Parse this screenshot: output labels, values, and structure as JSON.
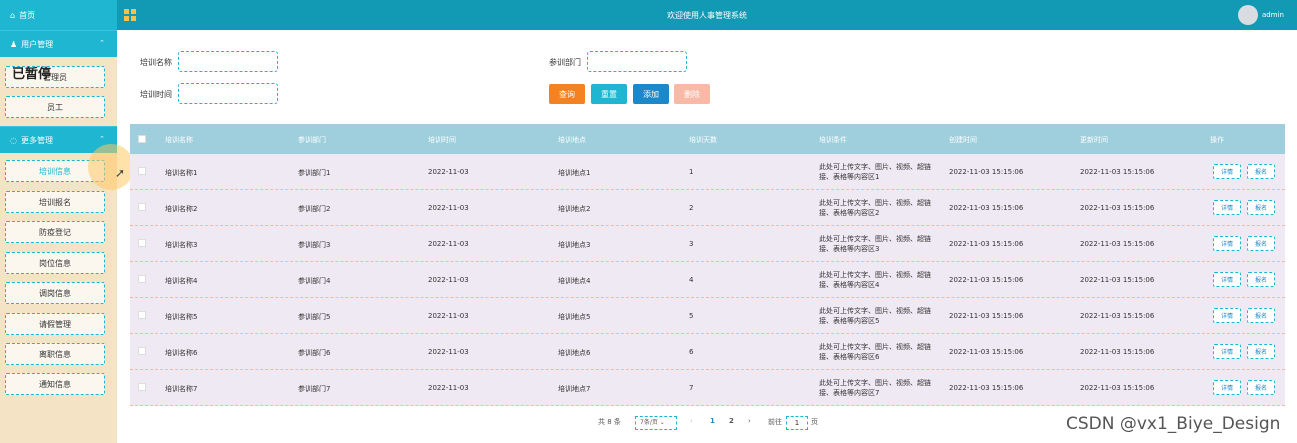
{
  "sidebar": {
    "home": "首页",
    "groups": [
      {
        "label": "用户管理"
      },
      {
        "label": "更多管理"
      }
    ],
    "user_items": [
      "管理员",
      "员工"
    ],
    "stopped_tag": "已暂停",
    "more_items": [
      "培训信息",
      "培训报名",
      "防疫登记",
      "岗位信息",
      "调岗信息",
      "请假管理",
      "离职信息",
      "通知信息"
    ]
  },
  "topbar": {
    "title": "欢迎使用人事管理系统",
    "user": "admin"
  },
  "filters": {
    "name_label": "培训名称",
    "dept_label": "参训部门",
    "time_label": "培训时间",
    "search": "查询",
    "reset": "重置",
    "add": "添加",
    "delete": "删除"
  },
  "table": {
    "headers": [
      "培训名称",
      "参训部门",
      "培训时间",
      "培训地点",
      "培训天数",
      "培训条件",
      "创建时间",
      "更新时间",
      "操作"
    ],
    "detail": "详情",
    "signup": "报名",
    "rows": [
      {
        "name": "培训名称1",
        "dept": "参训部门1",
        "time": "2022-11-03",
        "place": "培训地点1",
        "days": "1",
        "cond": "此处可上传文字、图片、视频、超链接、表格等内容区1",
        "created": "2022-11-03 15:15:06",
        "updated": "2022-11-03 15:15:06"
      },
      {
        "name": "培训名称2",
        "dept": "参训部门2",
        "time": "2022-11-03",
        "place": "培训地点2",
        "days": "2",
        "cond": "此处可上传文字、图片、视频、超链接、表格等内容区2",
        "created": "2022-11-03 15:15:06",
        "updated": "2022-11-03 15:15:06"
      },
      {
        "name": "培训名称3",
        "dept": "参训部门3",
        "time": "2022-11-03",
        "place": "培训地点3",
        "days": "3",
        "cond": "此处可上传文字、图片、视频、超链接、表格等内容区3",
        "created": "2022-11-03 15:15:06",
        "updated": "2022-11-03 15:15:06"
      },
      {
        "name": "培训名称4",
        "dept": "参训部门4",
        "time": "2022-11-03",
        "place": "培训地点4",
        "days": "4",
        "cond": "此处可上传文字、图片、视频、超链接、表格等内容区4",
        "created": "2022-11-03 15:15:06",
        "updated": "2022-11-03 15:15:06"
      },
      {
        "name": "培训名称5",
        "dept": "参训部门5",
        "time": "2022-11-03",
        "place": "培训地点5",
        "days": "5",
        "cond": "此处可上传文字、图片、视频、超链接、表格等内容区5",
        "created": "2022-11-03 15:15:06",
        "updated": "2022-11-03 15:15:06"
      },
      {
        "name": "培训名称6",
        "dept": "参训部门6",
        "time": "2022-11-03",
        "place": "培训地点6",
        "days": "6",
        "cond": "此处可上传文字、图片、视频、超链接、表格等内容区6",
        "created": "2022-11-03 15:15:06",
        "updated": "2022-11-03 15:15:06"
      },
      {
        "name": "培训名称7",
        "dept": "参训部门7",
        "time": "2022-11-03",
        "place": "培训地点7",
        "days": "7",
        "cond": "此处可上传文字、图片、视频、超链接、表格等内容区7",
        "created": "2022-11-03 15:15:06",
        "updated": "2022-11-03 15:15:06"
      }
    ]
  },
  "pagination": {
    "total": "共 8 条",
    "page_size": "7条/页",
    "prev": "‹",
    "pages": [
      "1",
      "2"
    ],
    "next": "›",
    "goto": "前往",
    "goto_value": "1",
    "page_unit": "页"
  },
  "watermark": "CSDN @vx1_Biye_Design",
  "colors": {
    "accent": "#1eb6d0",
    "topbar": "#1299b3",
    "sidebar_bg": "#f5e3c6",
    "search_btn": "#f58220",
    "add_btn": "#1a88c9",
    "delete_btn": "#f8b9a6",
    "table_head": "#9fcfdc",
    "row_bg": "#efe9f3"
  }
}
